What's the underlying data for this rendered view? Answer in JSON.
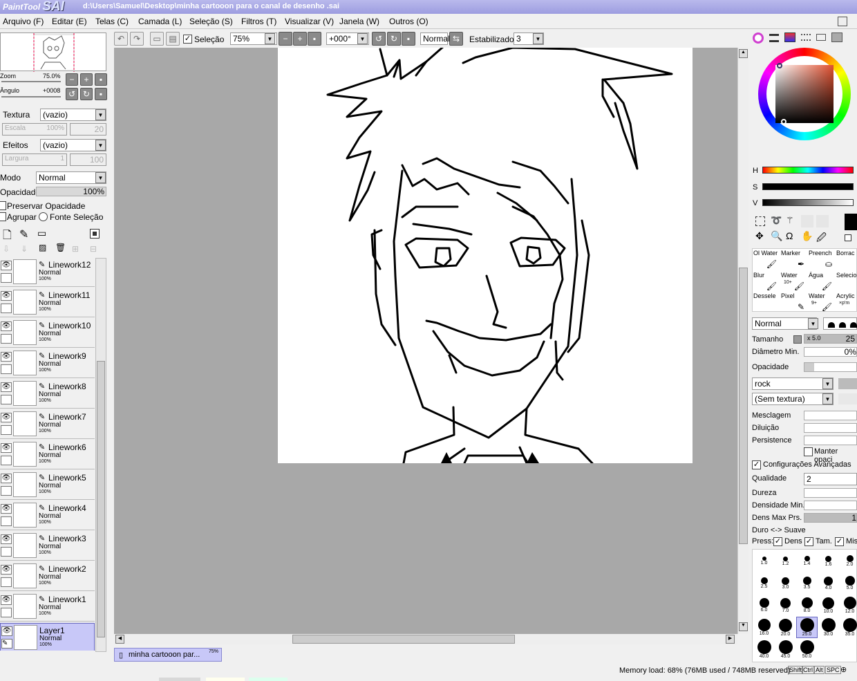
{
  "app": {
    "logo_small": "PaintTool",
    "logo_big": "SAI",
    "title": "d:\\Users\\Samuel\\Desktop\\minha cartooon para o canal de desenho .sai"
  },
  "menu": [
    "Arquivo (F)",
    "Editar (E)",
    "Telas (C)",
    "Camada (L)",
    "Seleção (S)",
    "Filtros (T)",
    "Visualizar (V)",
    "Janela (W)",
    "Outros (O)"
  ],
  "toolbar": {
    "selection_label": "Seleção",
    "zoom": "75%",
    "angle": "+000°",
    "blend": "Normal",
    "stabilizer_label": "Estabilizador",
    "stabilizer": "3"
  },
  "navigator": {
    "zoom_label": "Zoom",
    "zoom_value": "75.0%",
    "angle_label": "Ângulo",
    "angle_value": "+0008"
  },
  "texture": {
    "label": "Textura",
    "value": "(vazio)",
    "scale_label": "Escala",
    "scale_value": "100%",
    "scale_num": "20"
  },
  "effects": {
    "label": "Efeitos",
    "value": "(vazio)",
    "width_label": "Largura",
    "width_value": "1",
    "width_num": "100"
  },
  "layer_props": {
    "mode_label": "Modo",
    "mode_value": "Normal",
    "opacity_label": "Opacidade",
    "opacity_value": "100%",
    "preserve_label": "Preservar Opacidade",
    "group_label": "Agrupar",
    "source_label": "Fonte Seleção"
  },
  "layers": [
    {
      "name": "Linework12",
      "mode": "Normal",
      "opacity": "100%"
    },
    {
      "name": "Linework11",
      "mode": "Normal",
      "opacity": "100%"
    },
    {
      "name": "Linework10",
      "mode": "Normal",
      "opacity": "100%"
    },
    {
      "name": "Linework9",
      "mode": "Normal",
      "opacity": "100%"
    },
    {
      "name": "Linework8",
      "mode": "Normal",
      "opacity": "100%"
    },
    {
      "name": "Linework7",
      "mode": "Normal",
      "opacity": "100%"
    },
    {
      "name": "Linework6",
      "mode": "Normal",
      "opacity": "100%"
    },
    {
      "name": "Linework5",
      "mode": "Normal",
      "opacity": "100%"
    },
    {
      "name": "Linework4",
      "mode": "Normal",
      "opacity": "100%"
    },
    {
      "name": "Linework3",
      "mode": "Normal",
      "opacity": "100%"
    },
    {
      "name": "Linework2",
      "mode": "Normal",
      "opacity": "100%"
    },
    {
      "name": "Linework1",
      "mode": "Normal",
      "opacity": "100%"
    },
    {
      "name": "Layer1",
      "mode": "Normal",
      "opacity": "100%"
    }
  ],
  "colors": {
    "sel_layer": "#c8c8f8",
    "titlebar": "#9d9de0"
  },
  "sliders": {
    "h": "H",
    "s": "S",
    "v": "V"
  },
  "tools": [
    {
      "name": "Ol Water"
    },
    {
      "name": "Marker"
    },
    {
      "name": "Preench"
    },
    {
      "name": "Borrac"
    },
    {
      "name": "Blur"
    },
    {
      "name": "Water",
      "sub": "10+"
    },
    {
      "name": "Água"
    },
    {
      "name": "Selecio"
    },
    {
      "name": "Dessele"
    },
    {
      "name": "Pixel"
    },
    {
      "name": "Water",
      "sub": "9+"
    },
    {
      "name": "Acrylic",
      "sub": "×p'm"
    }
  ],
  "brush": {
    "mode": "Normal",
    "size_label": "Tamanho",
    "size_mult": "x 5.0",
    "size_value": "25",
    "min_diam_label": "Diâmetro Min.",
    "min_diam_value": "0%",
    "opacity_label": "Opacidade",
    "paper": "rock",
    "texture": "(Sem textura)",
    "blend_label": "Mesclagem",
    "dilution_label": "Diluição",
    "persistence_label": "Persistence",
    "keep_opacity_label": "Manter opaci",
    "advanced_label": "Configurações Avançadas",
    "quality_label": "Qualidade",
    "quality_value": "2",
    "hardness_label": "Dureza",
    "min_density_label": "Densidade Min.",
    "max_density_label": "Dens Max Prs.",
    "max_density_value": "1",
    "hard_soft_label": "Duro <-> Suave",
    "press_label": "Press:",
    "press_dens": "Dens",
    "press_size": "Tam.",
    "press_mix": "Mis"
  },
  "brush_sizes": [
    "1.0",
    "1.2",
    "1.4",
    "1.6",
    "2.0",
    "2.5",
    "3.0",
    "3.5",
    "4.0",
    "5.0",
    "6.0",
    "7.0",
    "8.0",
    "10.0",
    "12.0",
    "16.0",
    "20.0",
    "25.0",
    "30.0",
    "35.0",
    "40.0",
    "45.0",
    "50.0"
  ],
  "brush_sizes_selected_index": 17,
  "document_tab": {
    "name": "minha cartooon par...",
    "zoom": "75%"
  },
  "status": {
    "memory": "Memory load: 68% (76MB used / 748MB reserved)",
    "keys": [
      "Shift",
      "Ctrl",
      "Alt",
      "SPC"
    ]
  }
}
